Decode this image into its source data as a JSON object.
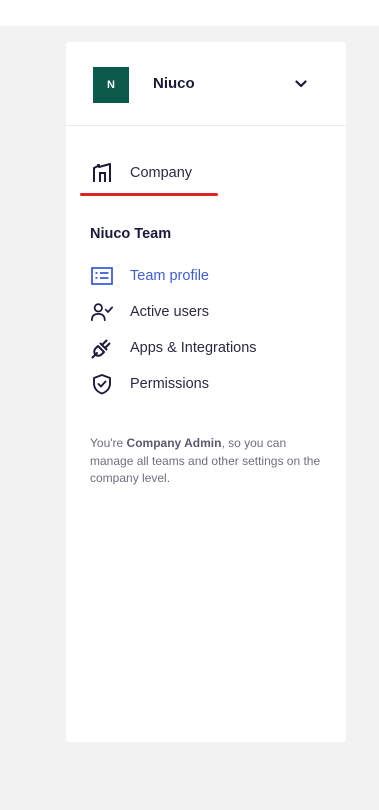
{
  "team_switcher": {
    "avatar_letter": "N",
    "team_name": "Niuco",
    "avatar_color": "#0b5a4b"
  },
  "nav": {
    "company": {
      "label": "Company",
      "icon": "building-icon"
    },
    "section_title": "Niuco Team",
    "items": [
      {
        "label": "Team profile",
        "icon": "id-card-icon",
        "active": true
      },
      {
        "label": "Active users",
        "icon": "user-check-icon",
        "active": false
      },
      {
        "label": "Apps & Integrations",
        "icon": "plug-icon",
        "active": false
      },
      {
        "label": "Permissions",
        "icon": "shield-check-icon",
        "active": false
      }
    ]
  },
  "admin_note": {
    "prefix": "You're ",
    "role": "Company Admin",
    "suffix": ", so you can manage all teams and other settings on the company level."
  },
  "colors": {
    "accent": "#3f5fd9",
    "highlight": "#e02424",
    "background": "#f2f2f2"
  }
}
